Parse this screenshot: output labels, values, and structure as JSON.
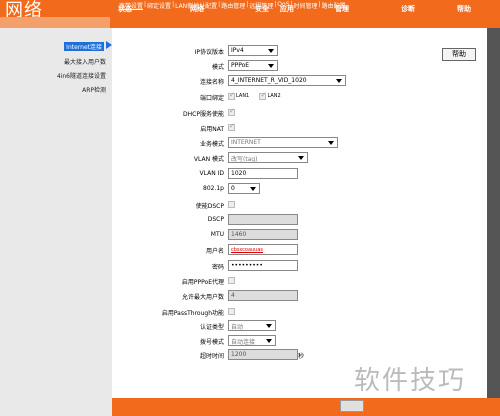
{
  "header": {
    "logo": "网络",
    "nav": [
      "状态",
      "网络",
      "安全",
      "应用",
      "管理",
      "诊断",
      "帮助"
    ],
    "active_nav": "网络"
  },
  "subnav": {
    "items": [
      "宽带设置",
      "绑定设置",
      "LAN侧地址配置",
      "路由管理",
      "远程管理",
      "QoS",
      "时间管理",
      "路由配置"
    ],
    "active": "宽带设置"
  },
  "sidebar": {
    "items": [
      "Internet连接",
      "最大接入用户数",
      "4in6隧道连接设置",
      "ARP检测"
    ],
    "active": "Internet连接"
  },
  "form": {
    "ip_protocol_label": "IP协议版本",
    "ip_protocol_value": "IPv4",
    "mode_label": "模式",
    "mode_value": "PPPoE",
    "conn_name_label": "连接名称",
    "conn_name_value": "4_INTERNET_R_VID_1020",
    "port_bind_label": "端口绑定",
    "port_bind_options": [
      "LAN1",
      "LAN2"
    ],
    "dhcp_label": "DHCP服务使能",
    "nat_label": "启用NAT",
    "service_mode_label": "业务模式",
    "service_mode_value": "INTERNET",
    "vlan_mode_label": "VLAN 模式",
    "vlan_mode_value": "改写(tag)",
    "vlan_id_label": "VLAN ID",
    "vlan_id_value": "1020",
    "dot1p_label": "802.1p",
    "dot1p_value": "0",
    "dscp_enable_label": "使能DSCP",
    "dscp_label": "DSCP",
    "dscp_value": "",
    "mtu_label": "MTU",
    "mtu_value": "1460",
    "username_label": "用户名",
    "username_value": "cbsscoauuas",
    "password_label": "密码",
    "password_value": "•••••••••",
    "pppoe_proxy_label": "启用PPPoE代理",
    "max_users_label": "允许最大用户数",
    "max_users_value": "4",
    "passthrough_label": "启用PassThrough功能",
    "auth_type_label": "认证类型",
    "auth_type_value": "自动",
    "dial_mode_label": "拨号模式",
    "dial_mode_value": "自动连接",
    "timeout_label": "超时时间",
    "timeout_value": "1200",
    "timeout_unit": "秒"
  },
  "right": {
    "help_label": "帮助"
  },
  "watermark": "软件技巧"
}
